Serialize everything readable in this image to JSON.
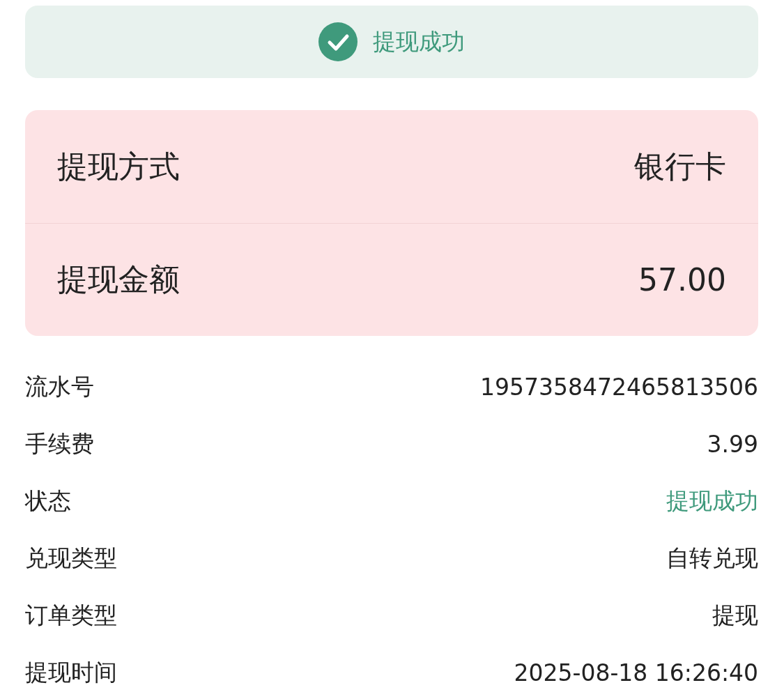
{
  "banner": {
    "success": true,
    "text": "提现成功"
  },
  "summary": [
    {
      "label": "提现方式",
      "value": "银行卡"
    },
    {
      "label": "提现金额",
      "value": "57.00"
    }
  ],
  "details": [
    {
      "label": "流水号",
      "value": "1957358472465813506"
    },
    {
      "label": "手续费",
      "value": "3.99"
    },
    {
      "label": "状态",
      "value": "提现成功",
      "color": "#3f9a7c"
    },
    {
      "label": "兑现类型",
      "value": "自转兑现"
    },
    {
      "label": "订单类型",
      "value": "提现"
    },
    {
      "label": "提现时间",
      "value": "2025-08-18 16:26:40"
    }
  ]
}
